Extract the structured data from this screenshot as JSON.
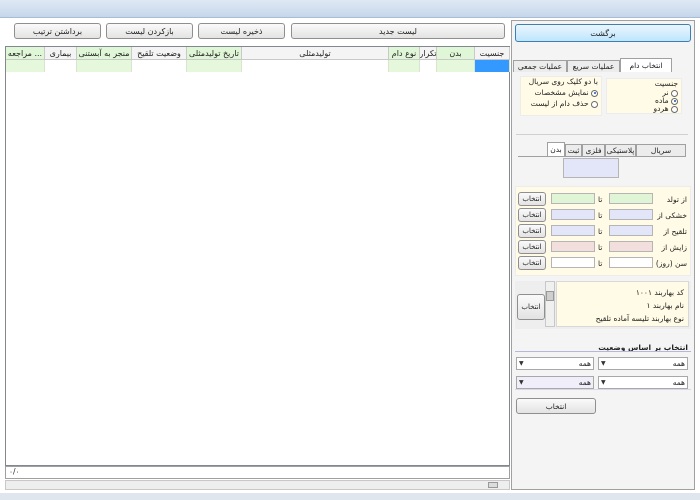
{
  "toolbar": {
    "remove_sort": "برداشتن ترتیب",
    "restore_list": "بازکردن لیست",
    "save_list": "ذخیره لیست",
    "new_list": "لیست جدید",
    "back": "برگشت"
  },
  "grid": {
    "columns": [
      "جنسیت",
      "بدن",
      "تکرار",
      "نوع دام",
      "تولیدمثلی",
      "تاریخ تولیدمثلی",
      "وضعیت تلقیح",
      "منجر به آبستنی",
      "بیماری",
      "مراجعه ..."
    ],
    "footer_status": "۰/۰"
  },
  "tabs": {
    "main": [
      "انتخاب دام",
      "عملیات سریع",
      "عملیات جمعی"
    ],
    "sub": [
      "سریال",
      "پلاستیکی",
      "فلزی",
      "ثبت",
      "بدن"
    ]
  },
  "gender": {
    "title": "جنسیت",
    "options": [
      "نر",
      "ماده",
      "هردو"
    ],
    "selected": "ماده"
  },
  "serial_click": {
    "title": "با دو کلیک روی سریال",
    "options": [
      "نمایش مشخصات",
      "حذف دام از لیست"
    ],
    "selected": "نمایش مشخصات"
  },
  "ranges": [
    {
      "label": "از تولد",
      "to": "تا",
      "select": "انتخاب"
    },
    {
      "label": "خشکی از",
      "to": "تا",
      "select": "انتخاب"
    },
    {
      "label": "تلقیح از",
      "to": "تا",
      "select": "انتخاب"
    },
    {
      "label": "زایش از",
      "to": "تا",
      "select": "انتخاب"
    },
    {
      "label": "سن (روز) از",
      "to": "تا",
      "select": "انتخاب"
    }
  ],
  "program": {
    "lines": [
      "کد بهاربند ۱۰۰۱",
      "نام بهاربند ۱",
      "نوع بهاربند تلیسه آماده تلقیح"
    ],
    "select": "انتخاب"
  },
  "status_section": {
    "title": "انتخاب بر اساس وضعیت",
    "selects": [
      "همه",
      "همه",
      "همه",
      "همه"
    ],
    "select_button": "انتخاب"
  },
  "colors": {
    "green_cell": "#dff5d6",
    "blue_cell": "#e2e6f8",
    "pink_cell": "#f3dede",
    "selection": "#3399ff"
  }
}
